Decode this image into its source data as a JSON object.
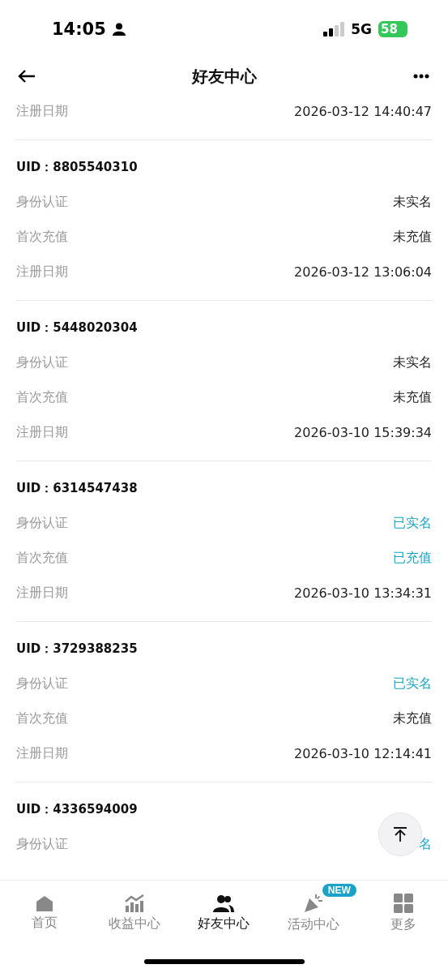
{
  "status_bar": {
    "time": "14:05",
    "network": "5G",
    "battery": "58"
  },
  "header": {
    "title": "好友中心"
  },
  "partial_record": {
    "rows": [
      {
        "label": "注册日期",
        "value": "2026-03-12 14:40:47",
        "done": false
      }
    ]
  },
  "records": [
    {
      "uid": "UID：8805540310",
      "rows": [
        {
          "label": "身份认证",
          "value": "未实名",
          "done": false
        },
        {
          "label": "首次充值",
          "value": "未充值",
          "done": false
        },
        {
          "label": "注册日期",
          "value": "2026-03-12 13:06:04",
          "done": false
        }
      ]
    },
    {
      "uid": "UID：5448020304",
      "rows": [
        {
          "label": "身份认证",
          "value": "未实名",
          "done": false
        },
        {
          "label": "首次充值",
          "value": "未充值",
          "done": false
        },
        {
          "label": "注册日期",
          "value": "2026-03-10 15:39:34",
          "done": false
        }
      ]
    },
    {
      "uid": "UID：6314547438",
      "rows": [
        {
          "label": "身份认证",
          "value": "已实名",
          "done": true
        },
        {
          "label": "首次充值",
          "value": "已充值",
          "done": true
        },
        {
          "label": "注册日期",
          "value": "2026-03-10 13:34:31",
          "done": false
        }
      ]
    },
    {
      "uid": "UID：3729388235",
      "rows": [
        {
          "label": "身份认证",
          "value": "已实名",
          "done": true
        },
        {
          "label": "首次充值",
          "value": "未充值",
          "done": false
        },
        {
          "label": "注册日期",
          "value": "2026-03-10 12:14:41",
          "done": false
        }
      ]
    },
    {
      "uid": "UID：4336594009",
      "rows": [
        {
          "label": "身份认证",
          "value": "名",
          "done": true
        }
      ]
    }
  ],
  "tab_bar": [
    {
      "kind": "home",
      "label": "首页",
      "selected": false
    },
    {
      "kind": "earnings",
      "label": "收益中心",
      "selected": false
    },
    {
      "kind": "friends",
      "label": "好友中心",
      "selected": true
    },
    {
      "kind": "events",
      "label": "活动中心",
      "selected": false,
      "badge": "NEW"
    },
    {
      "kind": "more",
      "label": "更多",
      "selected": false
    }
  ]
}
